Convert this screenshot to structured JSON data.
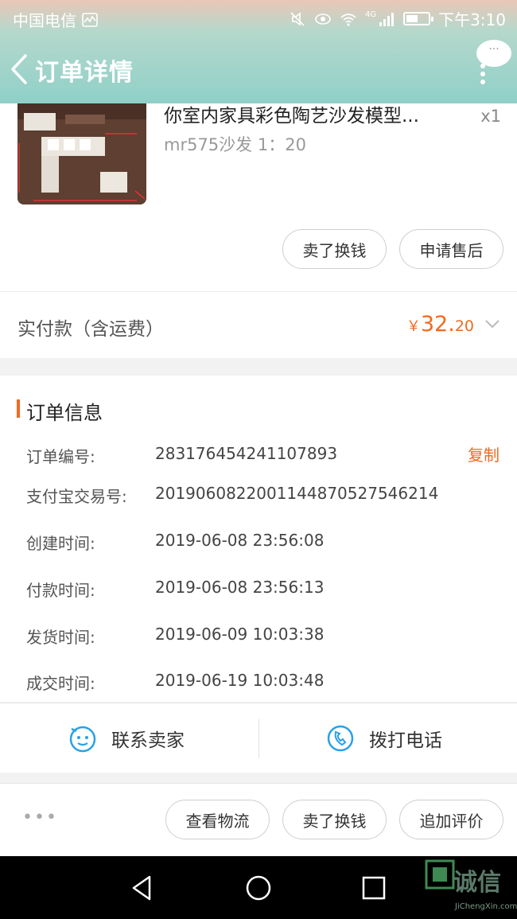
{
  "status_bar": {
    "carrier": "中国电信",
    "network": "4G",
    "time": "下午3:10",
    "icons": [
      "activity-icon",
      "mute-icon",
      "eye-icon",
      "wifi-icon",
      "signal-icon",
      "battery-icon"
    ]
  },
  "header": {
    "title": "订单详情",
    "bubble_text": "···"
  },
  "product": {
    "title": "你室内家具彩色陶艺沙发模型...",
    "spec": "mr575沙发 1：20",
    "qty": "x1"
  },
  "product_actions": {
    "sell_label": "卖了换钱",
    "aftersale_label": "申请售后"
  },
  "payment": {
    "label": "实付款（含运费）",
    "currency": "￥",
    "amount_int": "32.",
    "amount_dec": "20"
  },
  "order_info": {
    "title": "订单信息",
    "copy_label": "复制",
    "rows": [
      {
        "label": "订单编号:",
        "value": "283176454241107893"
      },
      {
        "label": "支付宝交易号:",
        "value": "2019060822001144870527546214"
      },
      {
        "label": "创建时间:",
        "value": "2019-06-08 23:56:08"
      },
      {
        "label": "付款时间:",
        "value": "2019-06-08 23:56:13"
      },
      {
        "label": "发货时间:",
        "value": "2019-06-09 10:03:38"
      },
      {
        "label": "成交时间:",
        "value": "2019-06-19 10:03:48"
      }
    ]
  },
  "contact": {
    "seller_label": "联系卖家",
    "call_label": "拨打电话"
  },
  "bottom_actions": {
    "more": "•••",
    "logistics_label": "查看物流",
    "sell_label": "卖了换钱",
    "review_label": "追加评价"
  },
  "watermark": {
    "text": "诚信",
    "sub": "JiChengXin.com"
  },
  "colors": {
    "accent": "#f06a20",
    "header": "#8fd0c8",
    "icon_blue": "#2aa0e8"
  }
}
